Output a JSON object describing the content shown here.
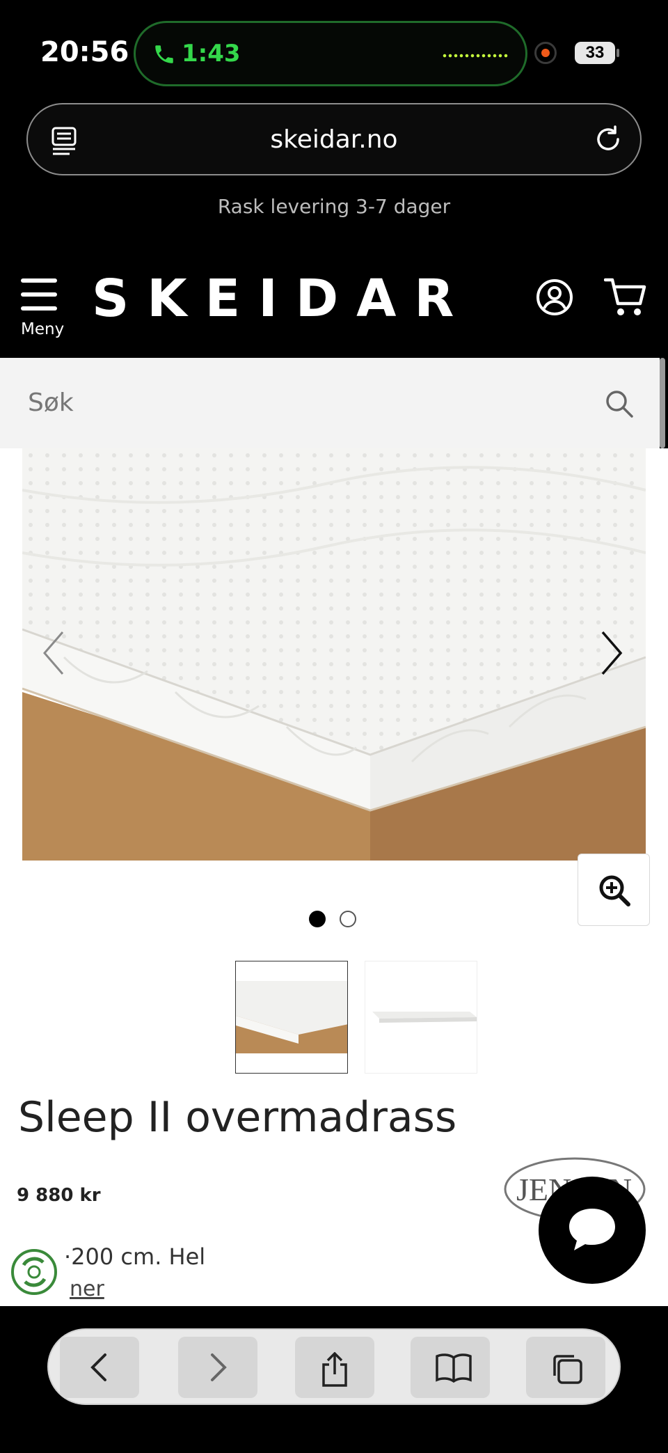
{
  "status_bar": {
    "time": "20:56",
    "call_duration": "1:43",
    "battery": "33"
  },
  "browser": {
    "url": "skeidar.no"
  },
  "promo": {
    "text": "Rask levering 3-7 dager"
  },
  "header": {
    "menu_label": "Meny",
    "logo_text": "SKEIDAR"
  },
  "search": {
    "placeholder": "Søk"
  },
  "product": {
    "title": "Sleep II overmadrass",
    "price": "9 880 kr",
    "description_fragment": "·200 cm. Hel",
    "link_fragment": "ner",
    "brand_logo_text": "JENSEN",
    "image_count": 2,
    "active_image": 1
  },
  "colors": {
    "accent_green": "#34d84b",
    "wood": "#b98a56",
    "background": "#ffffff",
    "header_bg": "#000000"
  },
  "icons": [
    "phone-icon",
    "reader-icon",
    "reload-icon",
    "menu-icon",
    "user-icon",
    "cart-icon",
    "search-icon",
    "chevron-left-icon",
    "chevron-right-icon",
    "zoom-in-icon",
    "eco-badge-icon",
    "chat-icon",
    "back-icon",
    "forward-icon",
    "share-icon",
    "bookmarks-icon",
    "tabs-icon"
  ]
}
